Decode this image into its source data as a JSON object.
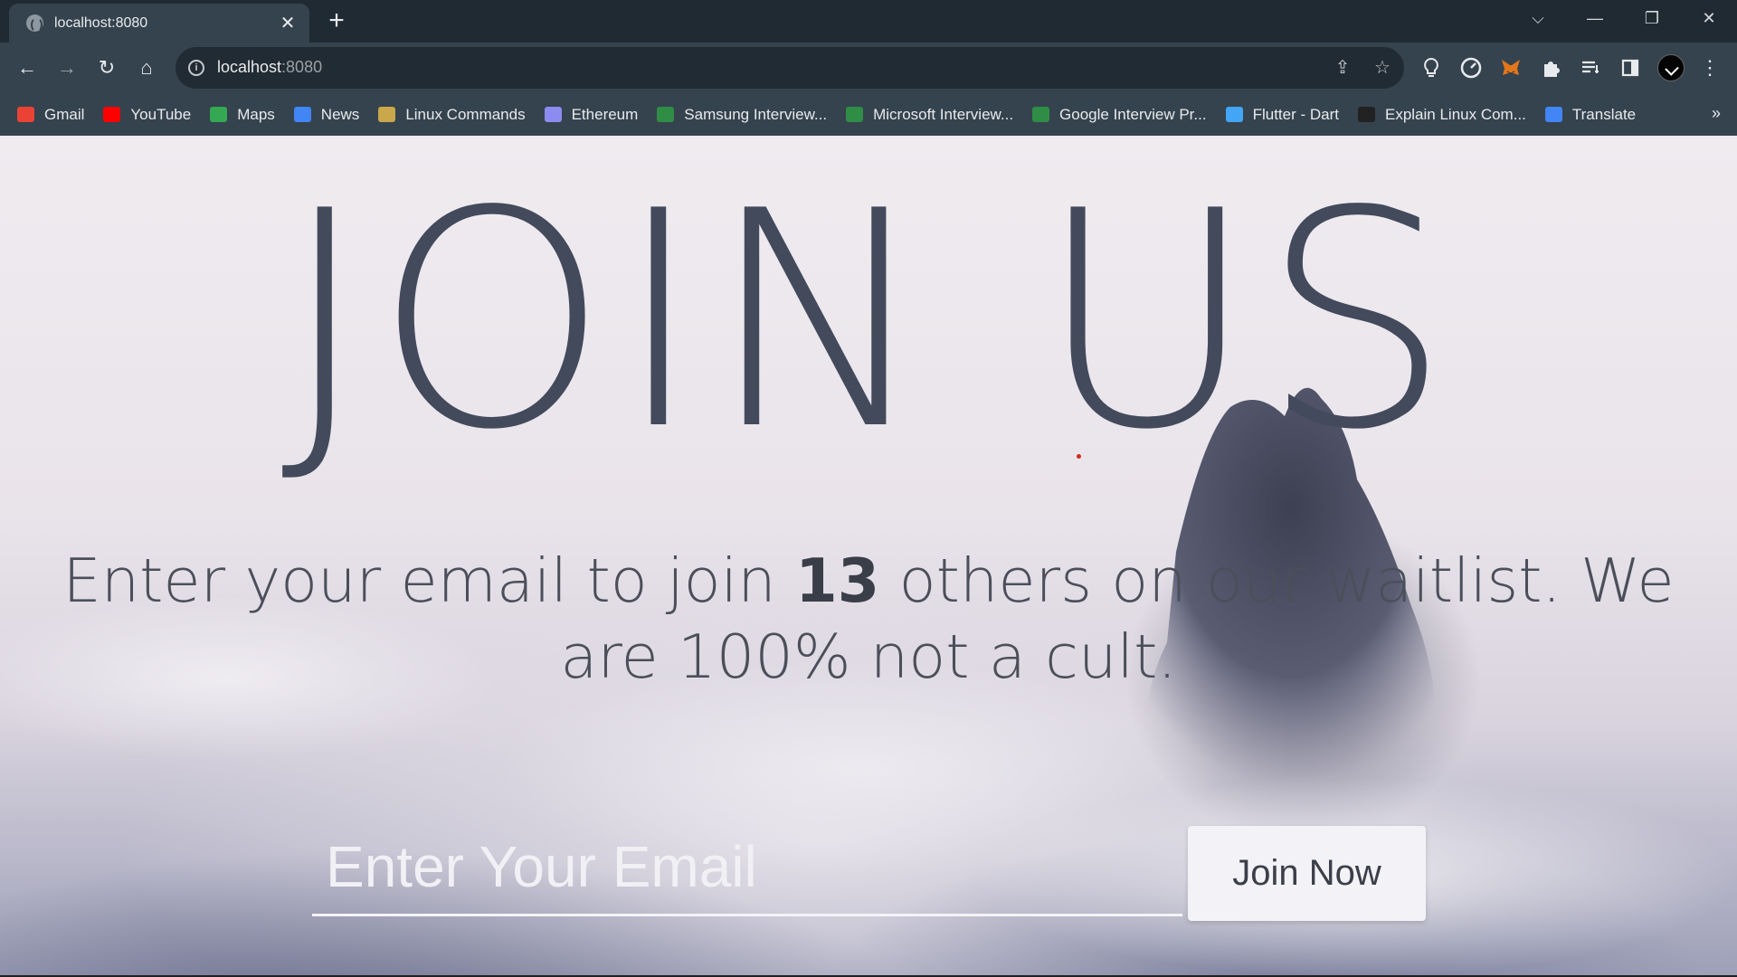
{
  "browser": {
    "tab": {
      "title": "localhost:8080",
      "close_glyph": "✕",
      "favicon": "globe-icon"
    },
    "new_tab_glyph": "+",
    "window_controls": {
      "tab_search": "⌵",
      "minimize": "—",
      "restore": "❐",
      "close": "✕"
    },
    "toolbar": {
      "back": "←",
      "forward": "→",
      "reload": "↻",
      "home": "⌂",
      "url_host": "localhost",
      "url_port": ":8080",
      "share": "⇪",
      "bookmark_star": "☆",
      "more": "⋮"
    },
    "bookmarks": [
      {
        "label": "Gmail",
        "icon": "gmail-icon",
        "color": "#ea4335"
      },
      {
        "label": "YouTube",
        "icon": "youtube-icon",
        "color": "#ff0000"
      },
      {
        "label": "Maps",
        "icon": "maps-icon",
        "color": "#34a853"
      },
      {
        "label": "News",
        "icon": "news-icon",
        "color": "#4285f4"
      },
      {
        "label": "Linux Commands",
        "icon": "linux-icon",
        "color": "#c9a74a"
      },
      {
        "label": "Ethereum",
        "icon": "ethereum-icon",
        "color": "#8c8cf0"
      },
      {
        "label": "Samsung Interview...",
        "icon": "gfg-icon",
        "color": "#2f8d46"
      },
      {
        "label": "Microsoft Interview...",
        "icon": "gfg-icon",
        "color": "#2f8d46"
      },
      {
        "label": "Google Interview Pr...",
        "icon": "gfg-icon",
        "color": "#2f8d46"
      },
      {
        "label": "Flutter - Dart",
        "icon": "flutter-icon",
        "color": "#42a5f5"
      },
      {
        "label": "Explain Linux Com...",
        "icon": "terminal-icon",
        "color": "#222222"
      },
      {
        "label": "Translate",
        "icon": "translate-icon",
        "color": "#4285f4"
      }
    ],
    "bookmarks_more": "»"
  },
  "page": {
    "headline": "JOIN US",
    "subline_before": "Enter your email to join ",
    "waitlist_count": "13",
    "subline_after": " others on our waitlist. We are 100% not a cult.",
    "email_placeholder": "Enter Your Email",
    "join_button": "Join Now"
  }
}
